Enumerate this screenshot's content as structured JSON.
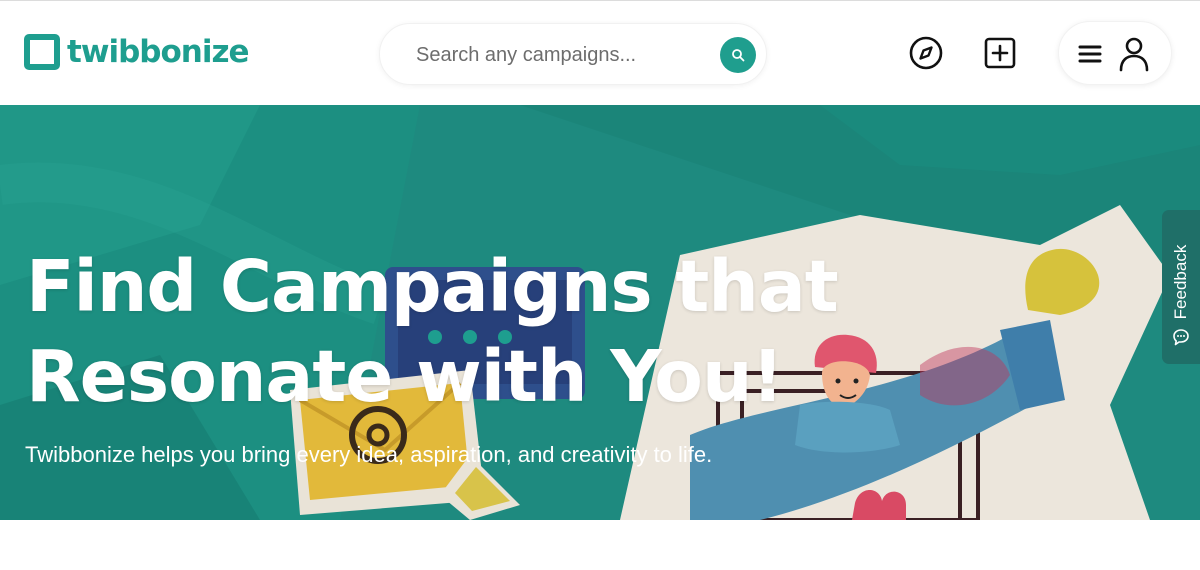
{
  "header": {
    "brand": "twibbonize",
    "search": {
      "placeholder": "Search any campaigns..."
    },
    "icons": {
      "search": "search-icon",
      "explore": "compass-icon",
      "create": "plus-square-icon",
      "menu": "hamburger-icon",
      "account": "user-icon"
    }
  },
  "hero": {
    "title_line1": "Find Campaigns that",
    "title_line2": "Resonate with You!",
    "subtitle": "Twibbonize helps you bring every idea, aspiration, and creativity to life."
  },
  "feedback": {
    "label": "Feedback",
    "icon": "chat-icon"
  },
  "colors": {
    "brand": "#1e9e8f",
    "hero_bg": "#1e8a7f",
    "feedback_bg": "#1f6f68"
  }
}
